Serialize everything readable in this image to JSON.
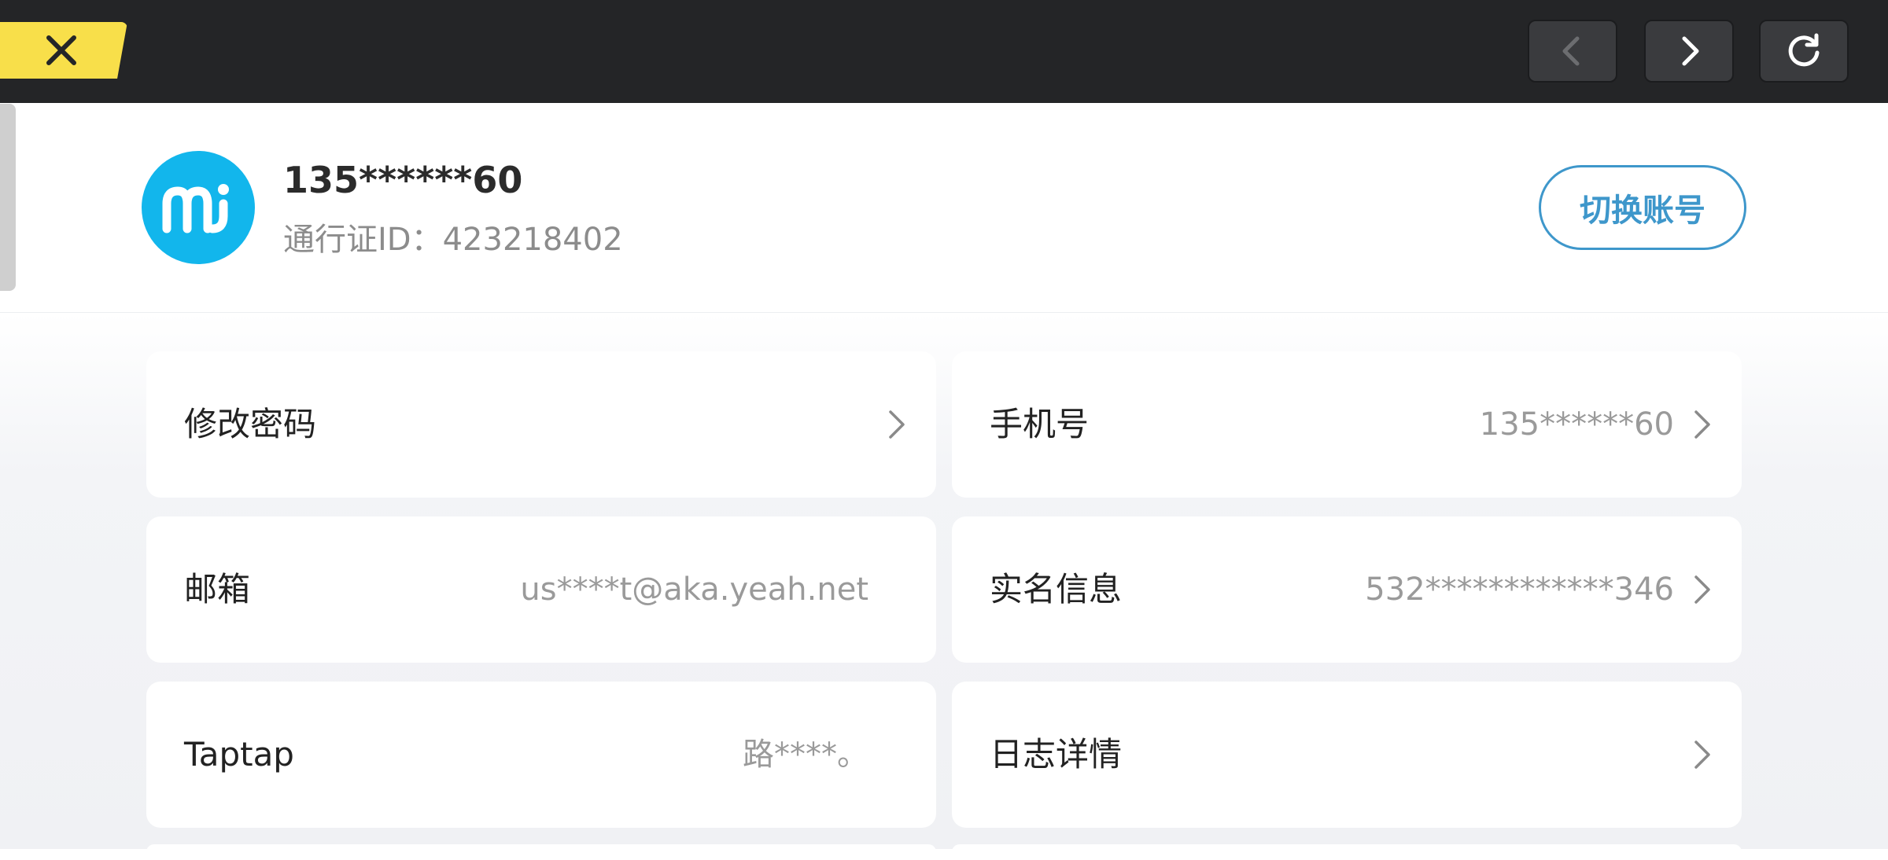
{
  "topbar": {
    "close_icon": "close-icon",
    "back_icon": "chevron-left-icon",
    "forward_icon": "chevron-right-icon",
    "reload_icon": "reload-icon",
    "accent": "#f8df4a"
  },
  "profile": {
    "avatar_icon": "mi-logo-icon",
    "phone": "135******60",
    "passport_id": "通行证ID：423218402",
    "switch_label": "切换账号"
  },
  "settings": [
    {
      "label": "修改密码",
      "value": "",
      "arrow": true
    },
    {
      "label": "手机号",
      "value": "135******60",
      "arrow": true
    },
    {
      "label": "邮箱",
      "value": "us****t@aka.yeah.net",
      "arrow": false
    },
    {
      "label": "实名信息",
      "value": "532************346",
      "arrow": true
    },
    {
      "label": "Taptap",
      "value": "路****。",
      "arrow": false
    },
    {
      "label": "日志详情",
      "value": "",
      "arrow": true
    }
  ],
  "colors": {
    "topbar_bg": "#242527",
    "brand_blue": "#12b6ec",
    "link_blue": "#3e97cb"
  }
}
